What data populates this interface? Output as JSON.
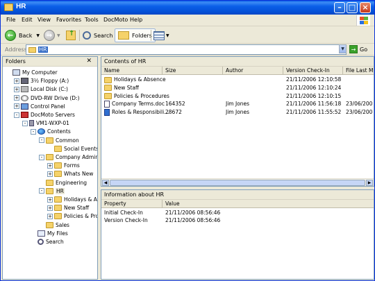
{
  "window": {
    "title": "HR"
  },
  "menu": [
    "File",
    "Edit",
    "View",
    "Favorites",
    "Tools",
    "DocMoto",
    "Help"
  ],
  "toolbar": {
    "back_label": "Back",
    "search_label": "Search",
    "folders_label": "Folders"
  },
  "address": {
    "label": "Address",
    "value": "HR",
    "go_label": "Go"
  },
  "folders_pane": {
    "title": "Folders",
    "tree": [
      {
        "label": "My Computer",
        "icon": "computer-icon",
        "level": 0,
        "expander": "",
        "type": "pc"
      },
      {
        "label": "3½ Floppy (A:)",
        "icon": "floppy-icon",
        "level": 1,
        "expander": "+",
        "type": "floppy"
      },
      {
        "label": "Local Disk (C:)",
        "icon": "disk-icon",
        "level": 1,
        "expander": "+",
        "type": "disk"
      },
      {
        "label": "DVD-RW Drive (D:)",
        "icon": "dvd-icon",
        "level": 1,
        "expander": "+",
        "type": "dvd"
      },
      {
        "label": "Control Panel",
        "icon": "control-panel-icon",
        "level": 1,
        "expander": "+",
        "type": "cp"
      },
      {
        "label": "DocMoto Servers",
        "icon": "server-icon",
        "level": 1,
        "expander": "-",
        "type": "server"
      },
      {
        "label": "VM1-WXP-01",
        "icon": "vm-icon",
        "level": 2,
        "expander": "-",
        "type": "vm"
      },
      {
        "label": "Contents",
        "icon": "globe-icon",
        "level": 3,
        "expander": "-",
        "type": "globe"
      },
      {
        "label": "Common",
        "icon": "folder-icon",
        "level": 4,
        "expander": "-",
        "type": "folder"
      },
      {
        "label": "Social Events",
        "icon": "folder-icon",
        "level": 5,
        "expander": "",
        "type": "folder"
      },
      {
        "label": "Company Administrat",
        "icon": "folder-icon",
        "level": 4,
        "expander": "-",
        "type": "folder"
      },
      {
        "label": "Forms",
        "icon": "folder-icon",
        "level": 5,
        "expander": "+",
        "type": "folder"
      },
      {
        "label": "Whats New",
        "icon": "folder-icon",
        "level": 5,
        "expander": "+",
        "type": "folder"
      },
      {
        "label": "Engineering",
        "icon": "folder-icon",
        "level": 4,
        "expander": "",
        "type": "folder"
      },
      {
        "label": "HR",
        "icon": "folder-icon",
        "level": 4,
        "expander": "-",
        "type": "folder"
      },
      {
        "label": "Holidays & Abser",
        "icon": "folder-icon",
        "level": 5,
        "expander": "+",
        "type": "folder"
      },
      {
        "label": "New Staff",
        "icon": "folder-icon",
        "level": 5,
        "expander": "+",
        "type": "folder"
      },
      {
        "label": "Policies & Proced",
        "icon": "folder-icon",
        "level": 5,
        "expander": "+",
        "type": "folder"
      },
      {
        "label": "Sales",
        "icon": "folder-icon",
        "level": 4,
        "expander": "",
        "type": "folder"
      },
      {
        "label": "My Files",
        "icon": "my-files-icon",
        "level": 3,
        "expander": "",
        "type": "files"
      },
      {
        "label": "Search",
        "icon": "search-icon",
        "level": 3,
        "expander": "",
        "type": "search"
      }
    ]
  },
  "contents_pane": {
    "title": "Contents of HR",
    "columns": [
      "Name",
      "Size",
      "Author",
      "Version Check-In",
      "File Last M"
    ],
    "rows": [
      {
        "name": "Holidays & Absence",
        "size": "",
        "author": "",
        "checkin": "21/11/2006 12:10:58",
        "lastmod": "",
        "type": "folder"
      },
      {
        "name": "New Staff",
        "size": "",
        "author": "",
        "checkin": "21/11/2006 12:10:24",
        "lastmod": "",
        "type": "folder"
      },
      {
        "name": "Policies & Procedures",
        "size": "",
        "author": "",
        "checkin": "21/11/2006 12:10:15",
        "lastmod": "",
        "type": "folder"
      },
      {
        "name": "Company Terms.doc",
        "size": "164352",
        "author": "Jim Jones",
        "checkin": "21/11/2006 11:56:18",
        "lastmod": "23/06/200",
        "type": "doc"
      },
      {
        "name": "Roles & Responsibili...",
        "size": "28672",
        "author": "Jim Jones",
        "checkin": "21/11/2006 11:55:52",
        "lastmod": "23/06/200",
        "type": "xls"
      }
    ]
  },
  "info_pane": {
    "title": "Information about HR",
    "columns": [
      "Property",
      "Value"
    ],
    "rows": [
      {
        "property": "Initial Check-In",
        "value": "21/11/2006 08:56:46"
      },
      {
        "property": "Version Check-In",
        "value": "21/11/2006 08:56:46"
      }
    ]
  }
}
